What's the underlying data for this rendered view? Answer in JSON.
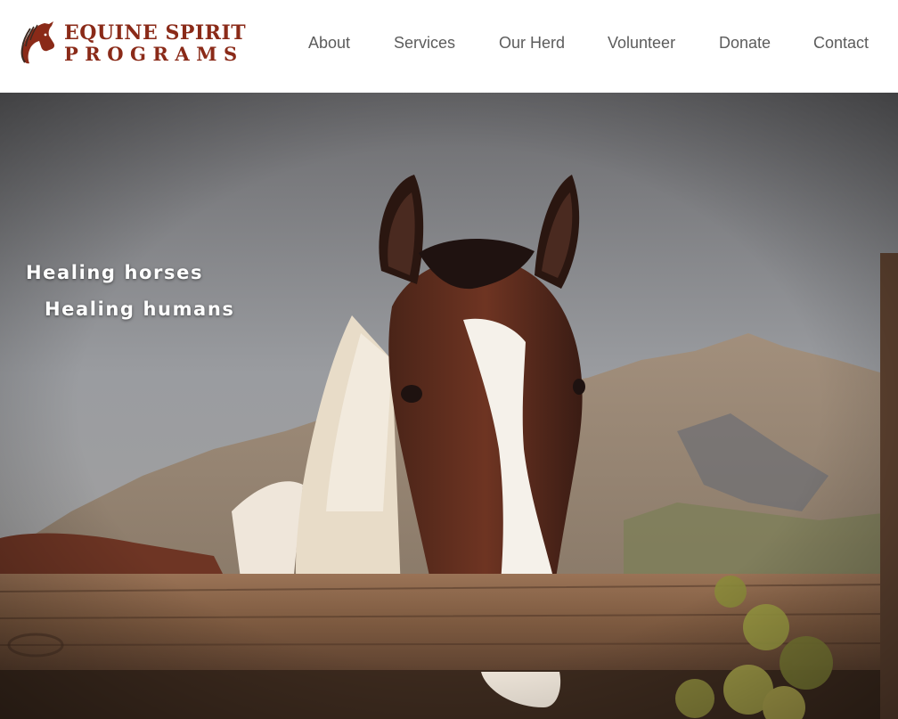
{
  "brand": {
    "line1": "EQUINE SPIRIT",
    "line2": "PROGRAMS",
    "logo_icon": "horse-head-icon",
    "color": "#8a2a18"
  },
  "nav": {
    "items": [
      {
        "label": "About"
      },
      {
        "label": "Services"
      },
      {
        "label": "Our Herd"
      },
      {
        "label": "Volunteer"
      },
      {
        "label": "Donate"
      },
      {
        "label": "Contact"
      }
    ],
    "color": "#5c5c5c"
  },
  "hero": {
    "line1": "Healing horses",
    "line2": "Healing humans",
    "image_subject": "paint horse with white blaze looking over wooden fence, mountains behind"
  }
}
